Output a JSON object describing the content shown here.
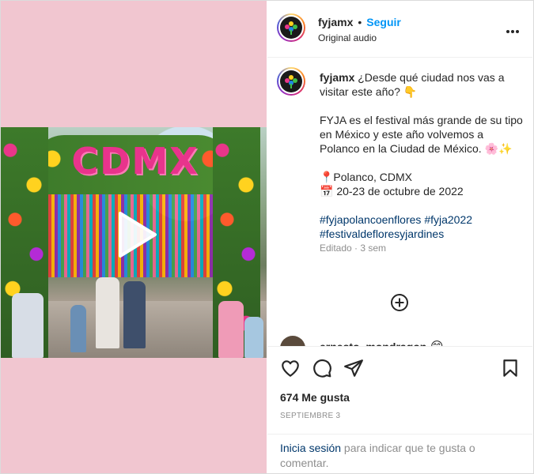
{
  "post": {
    "username": "fyjamx",
    "follow_label": "Seguir",
    "audio_label": "Original audio",
    "more_label": "•••",
    "sign_text": "CDMX"
  },
  "caption": {
    "username": "fyjamx",
    "line1": "¿Desde qué ciudad nos vas a visitar este año? 👇",
    "line2": "FYJA es el festival más grande de su tipo en México y este año volvemos a Polanco en la Ciudad de México. 🌸✨",
    "location": "📍Polanco, CDMX",
    "dates": "📅 20-23 de octubre de 2022",
    "hashtags": [
      "#fyjapolancoenflores",
      "#fyja2022",
      "#festivaldefloresyjardines"
    ],
    "edited": "Editado · 3 sem"
  },
  "next_comment": {
    "username": "ernesto_mondragon",
    "emoji": "😊"
  },
  "engagement": {
    "likes": "674 Me gusta",
    "date": "SEPTIEMBRE 3"
  },
  "login": {
    "link": "Inicia sesión",
    "rest": " para indicar que te gusta o comentar."
  },
  "icons": {
    "play": "play-icon",
    "like": "heart-icon",
    "comment": "comment-icon",
    "share": "share-icon",
    "save": "bookmark-icon",
    "add": "add-circle-icon"
  },
  "colors": {
    "accent": "#0095f6",
    "link": "#00376b",
    "media_bg": "#f1c6d0"
  }
}
